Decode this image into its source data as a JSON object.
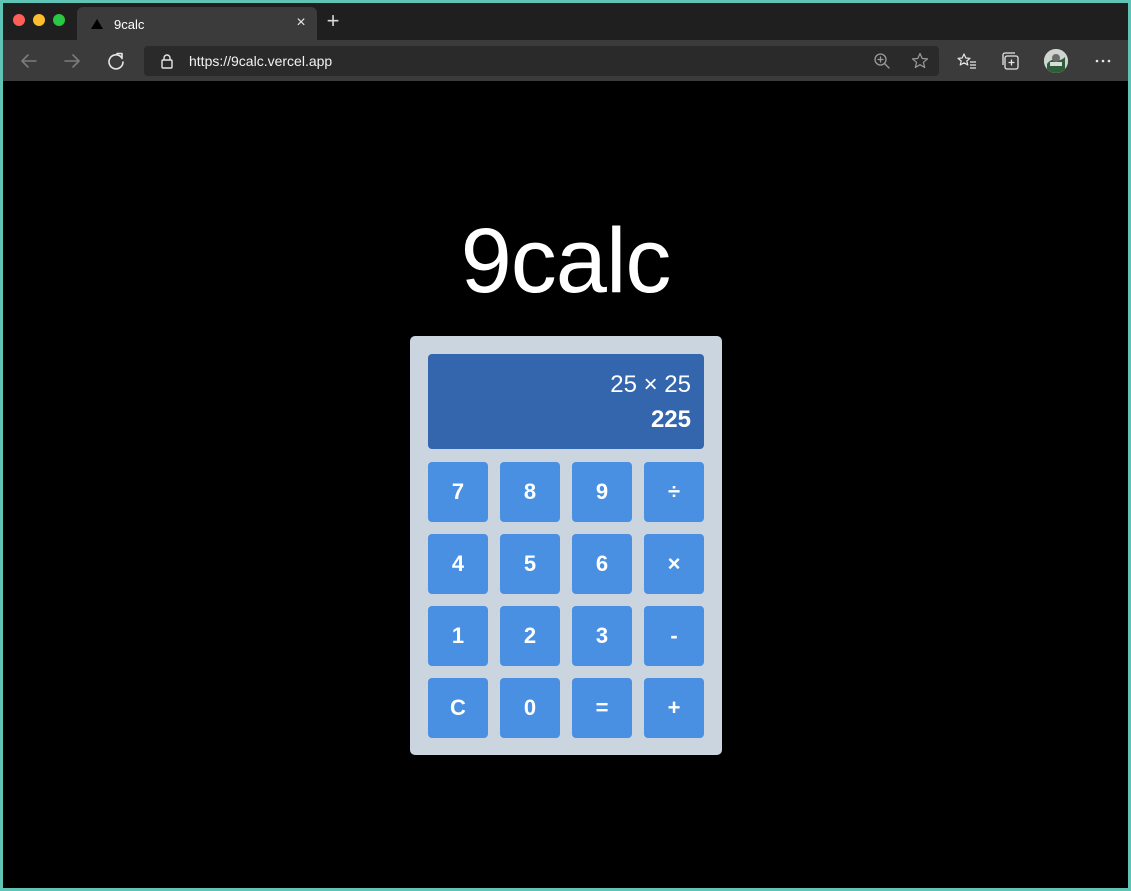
{
  "browser": {
    "tab": {
      "title": "9calc",
      "close_glyph": "×"
    },
    "new_tab_glyph": "+",
    "address": "https://9calc.vercel.app"
  },
  "page": {
    "title": "9calc"
  },
  "calculator": {
    "expression": "25 × 25",
    "result": "225",
    "keys": [
      {
        "label": "7",
        "name": "key-7"
      },
      {
        "label": "8",
        "name": "key-8"
      },
      {
        "label": "9",
        "name": "key-9"
      },
      {
        "label": "÷",
        "name": "key-divide"
      },
      {
        "label": "4",
        "name": "key-4"
      },
      {
        "label": "5",
        "name": "key-5"
      },
      {
        "label": "6",
        "name": "key-6"
      },
      {
        "label": "×",
        "name": "key-multiply"
      },
      {
        "label": "1",
        "name": "key-1"
      },
      {
        "label": "2",
        "name": "key-2"
      },
      {
        "label": "3",
        "name": "key-3"
      },
      {
        "label": "-",
        "name": "key-subtract"
      },
      {
        "label": "C",
        "name": "key-clear"
      },
      {
        "label": "0",
        "name": "key-0"
      },
      {
        "label": "=",
        "name": "key-equals"
      },
      {
        "label": "+",
        "name": "key-add"
      }
    ]
  },
  "colors": {
    "page_background": "#000000",
    "calculator_body": "#cbd5e0",
    "display_background": "#3466ad",
    "key_background": "#4a90e2"
  }
}
